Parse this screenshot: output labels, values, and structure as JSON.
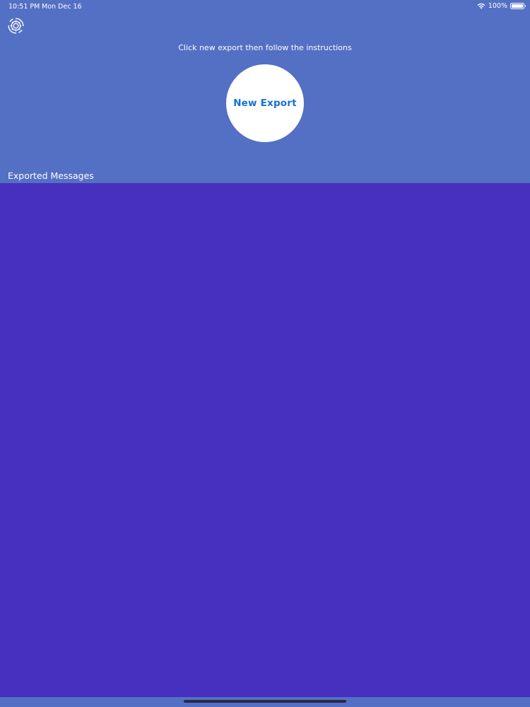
{
  "status_bar": {
    "time": "10:51 PM",
    "date": "Mon Dec 16",
    "battery_percent": "100%",
    "battery_level": 1.0,
    "wifi_icon": "wifi-icon",
    "battery_icon": "battery-icon"
  },
  "header": {
    "settings_icon": "gear-icon",
    "instruction": "Click new export then follow the instructions",
    "new_export_label": "New Export"
  },
  "messages": {
    "section_title": "Exported Messages",
    "items": []
  },
  "colors": {
    "header_background": "#5470c4",
    "list_background": "#4730bd",
    "button_background": "#ffffff",
    "button_text": "#1570d8",
    "text": "#ffffff"
  }
}
